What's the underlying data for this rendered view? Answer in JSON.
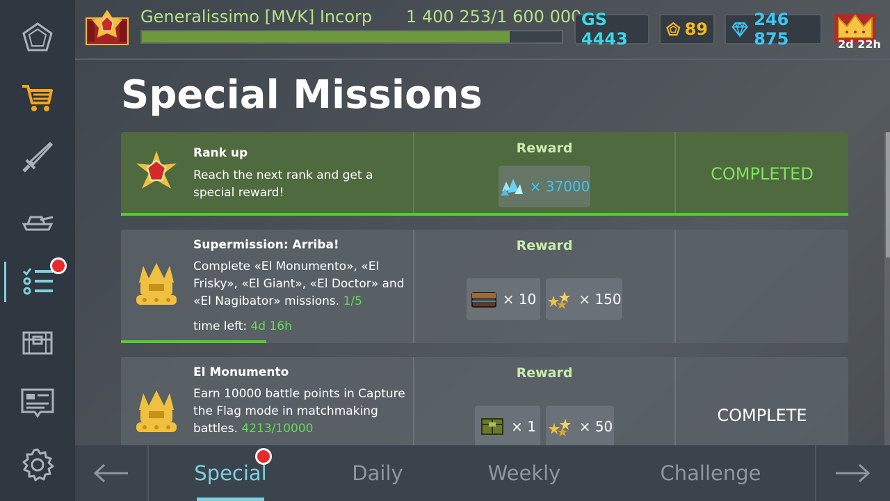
{
  "player": {
    "name": "Generalissimo [MVK] Incorp",
    "xp_text": "1 400 253/1 600 000",
    "xp_progress": 0.875
  },
  "stats": {
    "gs_label": "GS 4443",
    "gold": "89",
    "gems": "246 875",
    "premium_time": "2d 22h"
  },
  "sidebar": {
    "items": [
      {
        "name": "home",
        "icon": "pentagon-icon"
      },
      {
        "name": "shop",
        "icon": "cart-icon"
      },
      {
        "name": "weapons",
        "icon": "sword-icon"
      },
      {
        "name": "garage",
        "icon": "tank-icon"
      },
      {
        "name": "missions",
        "icon": "checklist-icon",
        "active": true,
        "notification": true
      },
      {
        "name": "containers",
        "icon": "chest-icon"
      },
      {
        "name": "news",
        "icon": "news-icon"
      },
      {
        "name": "settings",
        "icon": "gear-icon"
      }
    ]
  },
  "page_title": "Special Missions",
  "missions": [
    {
      "title": "Rank up",
      "description": "Reach the next rank and get a special reward!",
      "reward_label": "Reward",
      "rewards": [
        {
          "icon": "crystals-icon",
          "amount": "× 37000"
        }
      ],
      "status": "COMPLETED",
      "progress": 1.0
    },
    {
      "title": "Supermission: Arriba!",
      "description": "Complete «El Monumento», «El Frisky», «El Giant», «El Doctor» and «El Nagibator» missions.",
      "progress_text": "1/5",
      "time_left_label": "time left:",
      "time_left": "4d 16h",
      "reward_label": "Reward",
      "rewards": [
        {
          "icon": "container-icon",
          "amount": "× 10"
        },
        {
          "icon": "stars-icon",
          "amount": "× 150"
        }
      ],
      "status": "",
      "progress": 0.2
    },
    {
      "title": "El Monumento",
      "description": "Earn 10000 battle points in Capture the Flag mode in matchmaking battles.",
      "progress_text": "4213/10000",
      "reward_label": "Reward",
      "rewards": [
        {
          "icon": "supply-box-icon",
          "amount": "× 1"
        },
        {
          "icon": "stars-icon",
          "amount": "× 50"
        }
      ],
      "status": "COMPLETE",
      "progress": 0.4213
    }
  ],
  "tabs": [
    {
      "label": "Special",
      "active": true,
      "notification": true
    },
    {
      "label": "Daily"
    },
    {
      "label": "Weekly"
    },
    {
      "label": "Challenge"
    }
  ],
  "colors": {
    "accent": "#7fd0e0",
    "green_progress": "#55cc2e",
    "completed_text": "#7ee65a",
    "gold": "#f2b81e",
    "gems": "#3ec5f2",
    "notification": "#e52b2b"
  }
}
